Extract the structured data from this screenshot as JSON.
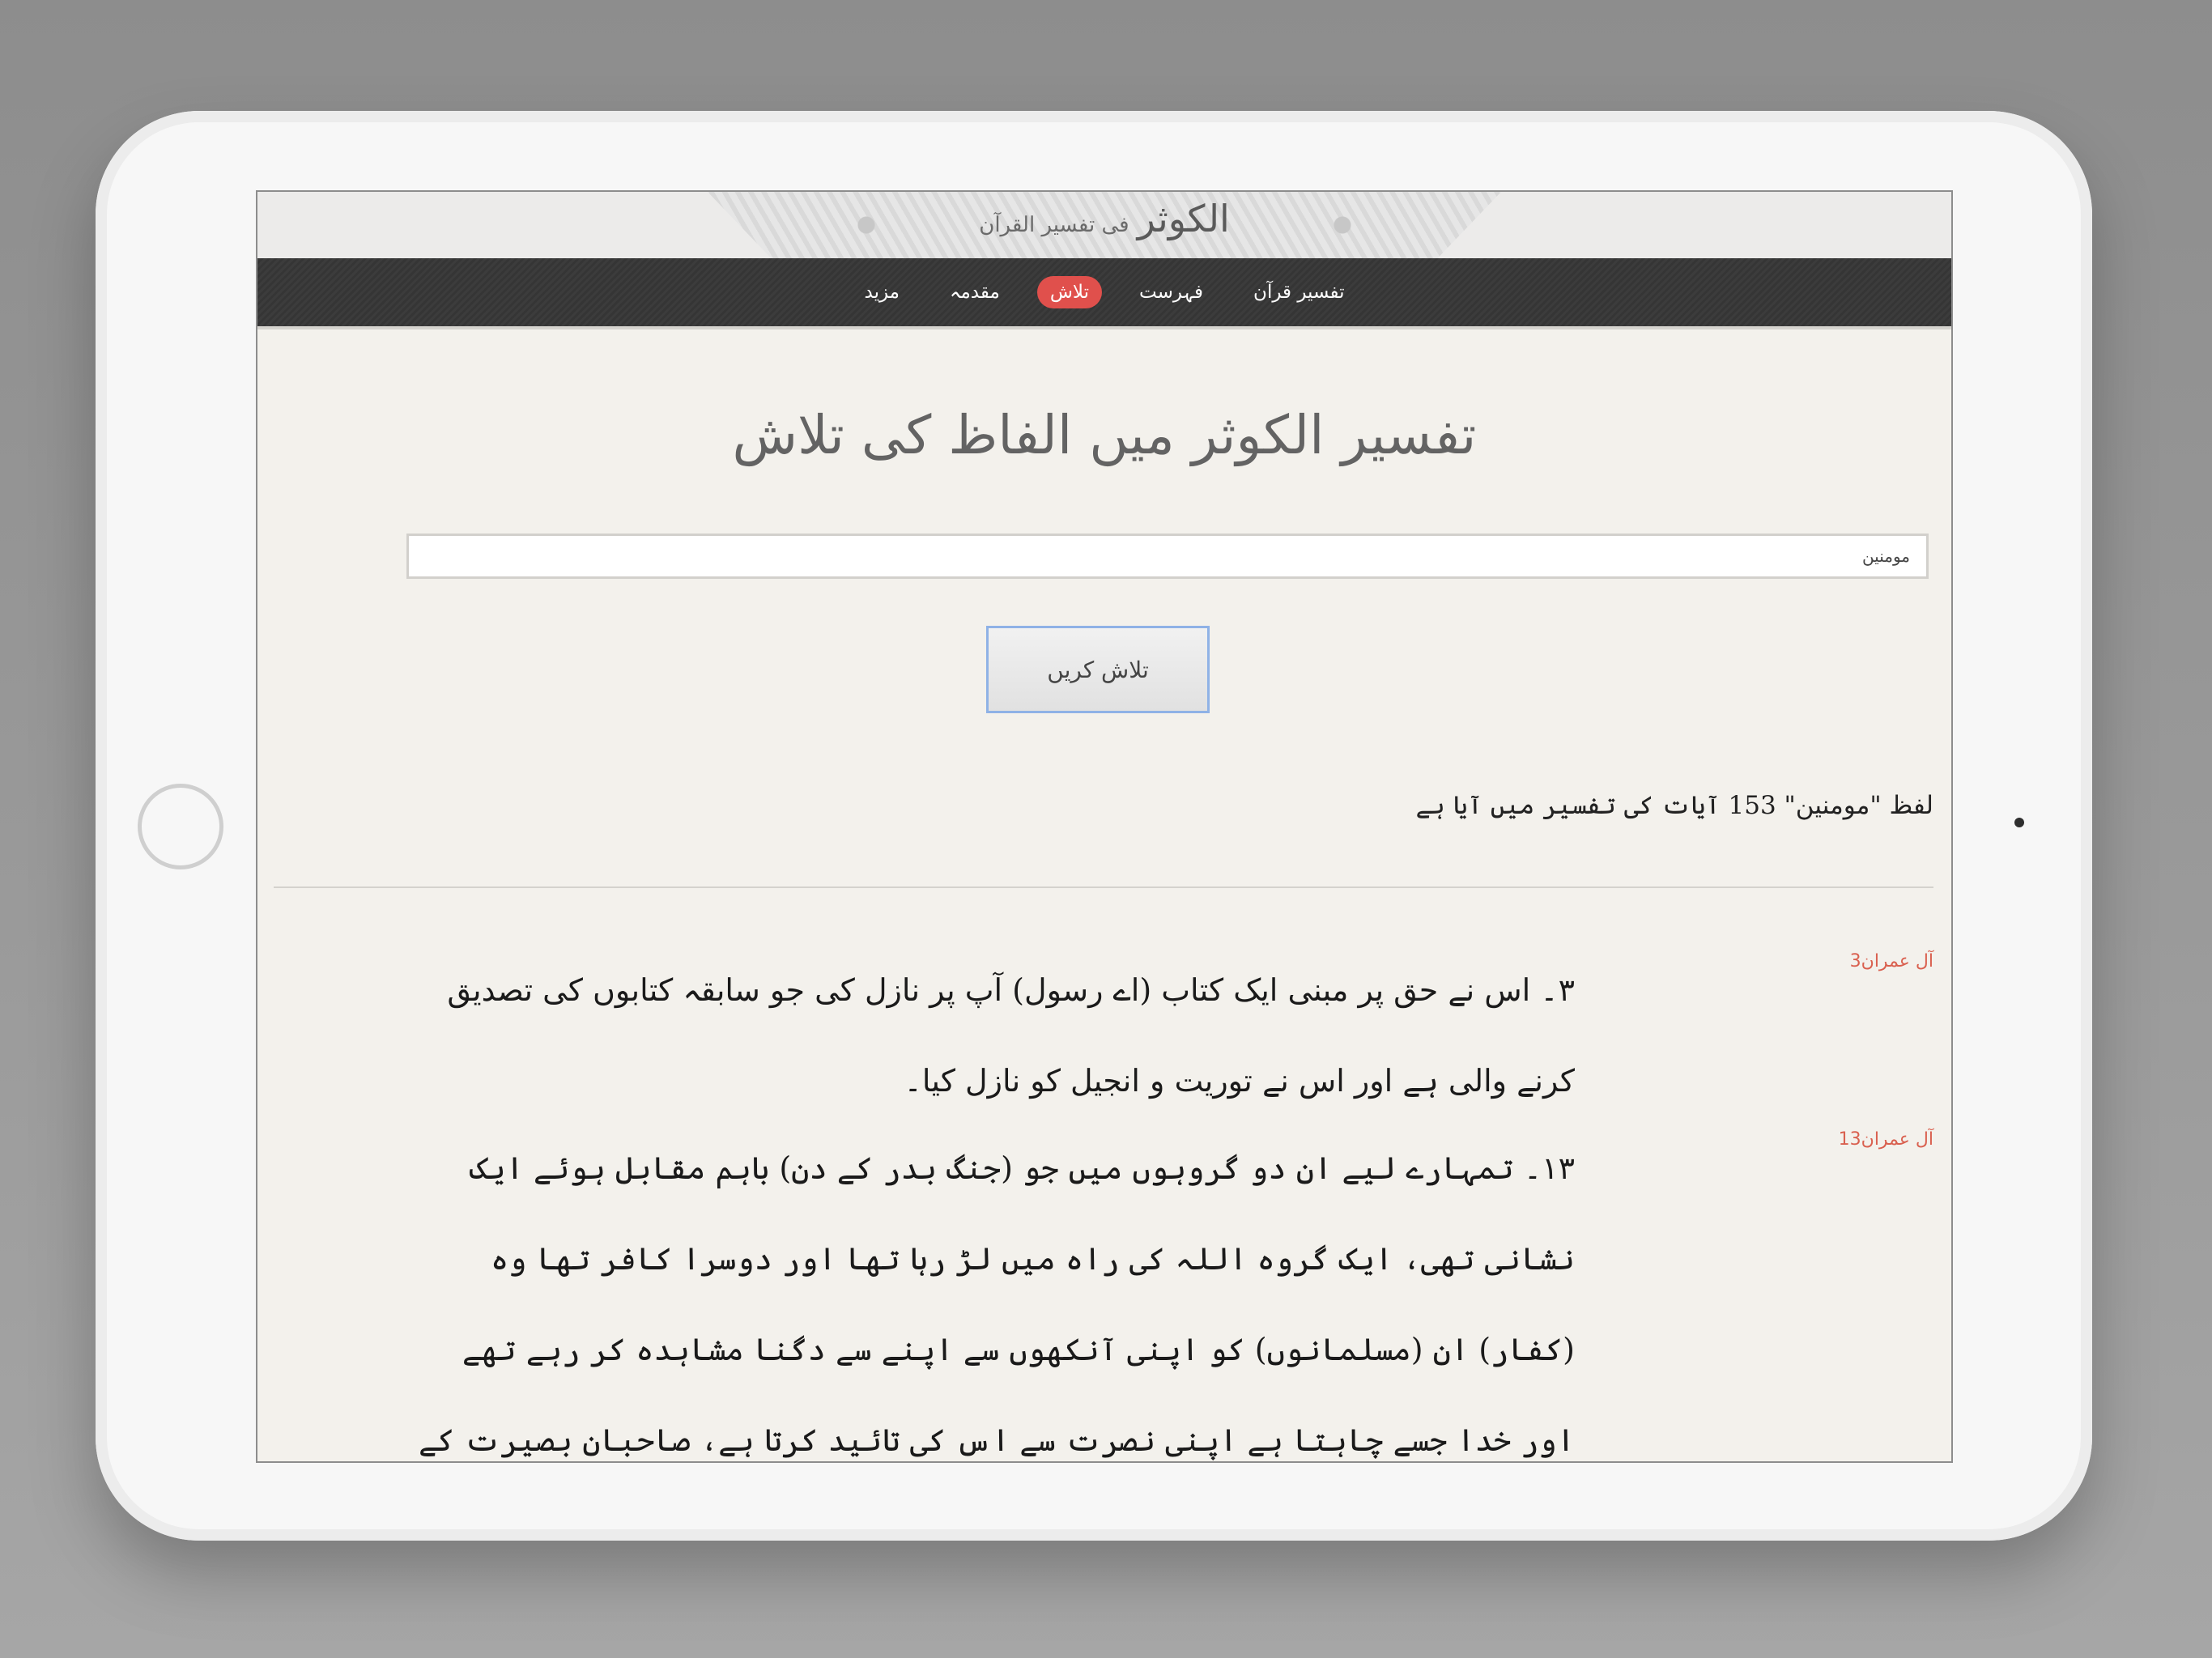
{
  "header": {
    "logo_main": "الکوثر",
    "logo_sub": "فی تفسیر القرآن"
  },
  "nav": {
    "items": [
      {
        "label": "تفسیر قرآن"
      },
      {
        "label": "فہرست"
      },
      {
        "label": "تلاش",
        "active": true
      },
      {
        "label": "مقدمہ"
      },
      {
        "label": "مزید"
      }
    ]
  },
  "main": {
    "title": "تفسیر الکوثر میں الفاظ کی تلاش",
    "search_value": "مومنین",
    "search_button_label": "تلاش کریں",
    "summary": "لفظ \"مومنین\" 153 آیات کی تفسیر میں آیا ہے"
  },
  "results": [
    {
      "ref": "آل عمران3",
      "text": "۳۔ اس نے حق پر مبنی ایک کتاب (اے رسول) آپ پر نازل کی جو سابقہ کتابوں کی تصدیق کرنے والی ہے اور اس نے توریت و انجیل کو نازل کیا۔"
    },
    {
      "ref": "آل عمران13",
      "text": "۱۳۔ تمہارے لیے ان دو گروہوں میں جو (جنگ بدر کے دن) باہم مقابل ہوئے ایک نشانی تھی، ایک گروہ اللہ کی راہ میں لڑ رہا تھا اور دوسرا کافر تھا وہ (کفار) ان (مسلمانوں) کو اپنی آنکھوں سے اپنے سے دگنا مشاہدہ کر رہے تھے اور خدا جسے چاہتا ہے اپنی نصرت سے اس کی تائید کرتا ہے، صاحبان بصیرت کے لیے اس واقعے میں یقینا بڑی عبرت ہے۔"
    }
  ],
  "colors": {
    "accent": "#e0504c",
    "reference": "#d9604f",
    "navbar": "#383838",
    "content_bg": "#f3f1ec"
  }
}
